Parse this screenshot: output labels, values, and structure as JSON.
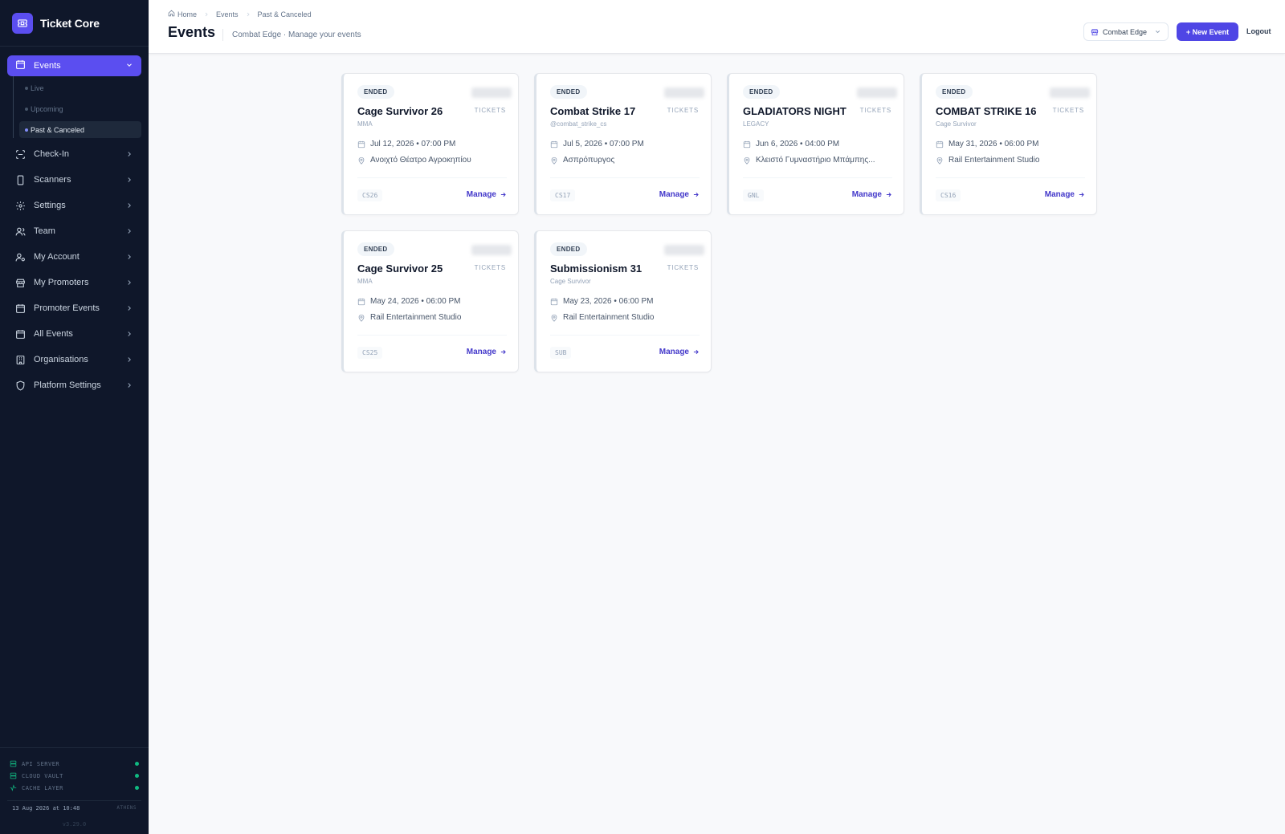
{
  "app": {
    "name": "Ticket Core"
  },
  "sidebar": {
    "active": {
      "label": "Events"
    },
    "subitems": [
      {
        "label": "Live"
      },
      {
        "label": "Upcoming"
      },
      {
        "label": "Past & Canceled"
      }
    ],
    "items": [
      {
        "label": "Check-In",
        "icon": "scan-icon"
      },
      {
        "label": "Scanners",
        "icon": "device-icon"
      },
      {
        "label": "Settings",
        "icon": "gear-icon"
      },
      {
        "label": "Team",
        "icon": "users-icon"
      },
      {
        "label": "My Account",
        "icon": "user-gear-icon"
      },
      {
        "label": "My Promoters",
        "icon": "store-icon"
      },
      {
        "label": "Promoter Events",
        "icon": "calendar-icon"
      },
      {
        "label": "All Events",
        "icon": "calendar-icon"
      },
      {
        "label": "Organisations",
        "icon": "building-icon"
      },
      {
        "label": "Platform Settings",
        "icon": "shield-icon"
      }
    ],
    "status": [
      {
        "label": "API SERVER",
        "state_color": "#10b981"
      },
      {
        "label": "CLOUD VAULT",
        "state_color": "#10b981"
      },
      {
        "label": "CACHE LAYER",
        "state_color": "#10b981"
      }
    ],
    "clock": {
      "datetime": "13 Aug 2026 at 10:48",
      "timezone": "ATHENS"
    },
    "version": "v3.29.0"
  },
  "header": {
    "breadcrumb": [
      "Home",
      "Events",
      "Past & Canceled"
    ],
    "title": "Events",
    "subtitle": "Combat Edge · Manage your events",
    "org_selector": "Combat Edge",
    "new_event": "+ New Event",
    "logout": "Logout"
  },
  "colors": {
    "accent": "#4f46e5",
    "sidebar_bg": "#0f172a",
    "status_ok": "#10b981"
  },
  "cards": [
    {
      "status": "ENDED",
      "title": "Cage Survivor 26",
      "subtitle": "MMA",
      "date": "Jul 12, 2026 • 07:00 PM",
      "venue": "Ανοιχτό Θέατρο Αγροκηπίου",
      "code": "CS26",
      "tickets_label": "TICKETS",
      "manage": "Manage"
    },
    {
      "status": "ENDED",
      "title": "Combat Strike 17",
      "subtitle": "@combat_strike_cs",
      "date": "Jul 5, 2026 • 07:00 PM",
      "venue": "Ασπρόπυργος",
      "code": "CS17",
      "tickets_label": "TICKETS",
      "manage": "Manage"
    },
    {
      "status": "ENDED",
      "title": "GLADIATORS NIGHT",
      "subtitle": "LEGACY",
      "date": "Jun 6, 2026 • 04:00 PM",
      "venue": "Κλειστό Γυμναστήριο Μπάμπης...",
      "code": "GNL",
      "tickets_label": "TICKETS",
      "manage": "Manage"
    },
    {
      "status": "ENDED",
      "title": "COMBAT STRIKE 16",
      "subtitle": "Cage Survivor",
      "date": "May 31, 2026 • 06:00 PM",
      "venue": "Rail Entertainment Studio",
      "code": "CS16",
      "tickets_label": "TICKETS",
      "manage": "Manage"
    },
    {
      "status": "ENDED",
      "title": "Cage Survivor 25",
      "subtitle": "MMA",
      "date": "May 24, 2026 • 06:00 PM",
      "venue": "Rail Entertainment Studio",
      "code": "CS25",
      "tickets_label": "TICKETS",
      "manage": "Manage"
    },
    {
      "status": "ENDED",
      "title": "Submissionism 31",
      "subtitle": "Cage Survivor",
      "date": "May 23, 2026 • 06:00 PM",
      "venue": "Rail Entertainment Studio",
      "code": "SUB",
      "tickets_label": "TICKETS",
      "manage": "Manage"
    }
  ]
}
